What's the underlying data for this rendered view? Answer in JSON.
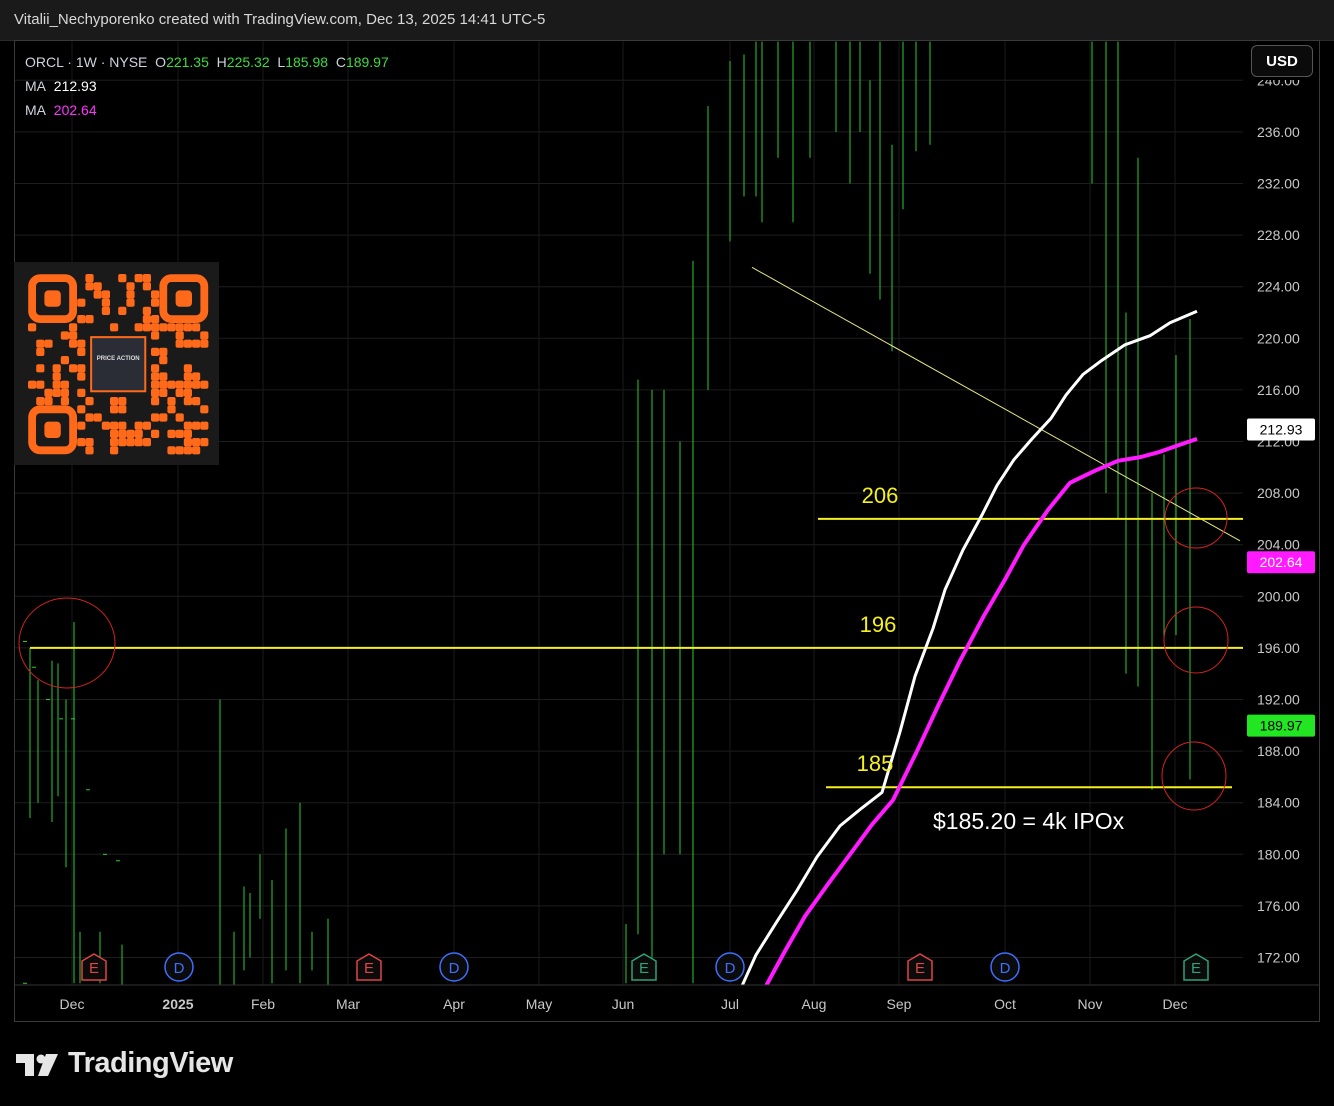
{
  "header": {
    "credit": "Vitalii_Nechyporenko created with TradingView.com, Dec 13, 2025 14:41 UTC-5"
  },
  "legend": {
    "symbol": "ORCL · 1W · NYSE",
    "o_label": "O",
    "o_value": "221.35",
    "h_label": "H",
    "h_value": "225.32",
    "l_label": "L",
    "l_value": "185.98",
    "c_label": "C",
    "c_value": "189.97",
    "ma1_label": "MA",
    "ma1_value": "212.93",
    "ma2_label": "MA",
    "ma2_value": "202.64"
  },
  "currency_button": "USD",
  "footer": {
    "brand": "TradingView"
  },
  "qr_label": "PRICE ACTION",
  "chart_data": {
    "type": "line",
    "y_axis": {
      "ticks": [
        "172.00",
        "176.00",
        "180.00",
        "184.00",
        "188.00",
        "192.00",
        "196.00",
        "200.00",
        "204.00",
        "208.00",
        "212.00",
        "216.00",
        "220.00",
        "224.00",
        "228.00",
        "232.00",
        "236.00",
        "240.00"
      ],
      "range": [
        169.8,
        243.5
      ]
    },
    "x_axis": {
      "ticks": [
        "Dec",
        "2025",
        "Feb",
        "Mar",
        "Apr",
        "May",
        "Jun",
        "Jul",
        "Aug",
        "Sep",
        "Oct",
        "Nov",
        "Dec"
      ]
    },
    "price_labels": [
      {
        "value": 212.93,
        "text": "212.93",
        "style": "ma1"
      },
      {
        "value": 202.64,
        "text": "202.64",
        "style": "ma2"
      },
      {
        "value": 189.97,
        "text": "189.97",
        "style": "last"
      }
    ],
    "horizontal_levels": [
      {
        "value": 206,
        "label": "206"
      },
      {
        "value": 196,
        "label": "196"
      },
      {
        "value": 185.2,
        "label": "185"
      }
    ],
    "annotation": "$185.20 = 4k IPOx",
    "events": [
      {
        "type": "E",
        "color": "red"
      },
      {
        "type": "D",
        "color": "blue"
      },
      {
        "type": "E",
        "color": "red"
      },
      {
        "type": "D",
        "color": "blue"
      },
      {
        "type": "E",
        "color": "green"
      },
      {
        "type": "D",
        "color": "blue"
      },
      {
        "type": "E",
        "color": "red"
      },
      {
        "type": "D",
        "color": "blue"
      },
      {
        "type": "E",
        "color": "green"
      }
    ],
    "series": [
      {
        "values": [
          [
            27,
            196.5
          ],
          [
            36,
            194.5
          ],
          [
            50,
            192
          ],
          [
            63,
            190.5
          ],
          [
            75,
            190.5
          ],
          [
            90,
            185
          ],
          [
            107,
            180
          ],
          [
            120,
            179.5
          ]
        ]
      },
      {
        "values": [
          [
            27,
            170
          ],
          [
            36,
            169.5
          ],
          [
            50,
            169.3
          ]
        ]
      }
    ],
    "bars": [
      [
        30,
        196,
        182.8
      ],
      [
        38,
        193.5,
        184
      ],
      [
        52,
        195,
        182.5
      ],
      [
        58,
        194.8,
        184.5
      ],
      [
        66,
        192,
        179
      ],
      [
        74,
        198,
        170
      ],
      [
        80,
        174,
        170
      ],
      [
        100,
        174,
        170
      ],
      [
        122,
        173,
        169.8
      ],
      [
        220,
        192,
        169.8
      ],
      [
        234,
        174,
        169.8
      ],
      [
        244,
        177.5,
        171
      ],
      [
        250,
        177,
        172
      ],
      [
        260,
        180,
        175
      ],
      [
        272,
        178,
        170
      ],
      [
        286,
        182,
        171
      ],
      [
        300,
        184,
        170
      ],
      [
        312,
        174,
        171
      ],
      [
        328,
        175,
        169.8
      ],
      [
        626,
        174.6,
        170
      ],
      [
        638,
        216.8,
        173.8
      ],
      [
        652,
        216,
        172
      ],
      [
        664,
        216,
        180
      ],
      [
        680,
        212,
        180
      ],
      [
        693,
        226,
        170
      ],
      [
        708,
        238,
        216
      ],
      [
        730,
        241.5,
        227.5
      ],
      [
        744,
        242,
        231
      ],
      [
        756,
        243,
        231
      ],
      [
        762,
        243,
        229
      ],
      [
        778,
        243,
        234
      ],
      [
        793,
        243,
        229
      ],
      [
        810,
        243,
        234
      ],
      [
        836,
        243,
        236
      ],
      [
        850,
        243,
        232
      ],
      [
        860,
        243,
        236
      ],
      [
        870,
        240,
        225
      ],
      [
        880,
        243,
        223
      ],
      [
        892,
        235,
        219
      ],
      [
        903,
        243,
        230
      ],
      [
        916,
        243,
        234.5
      ],
      [
        930,
        243,
        235
      ],
      [
        1092,
        243,
        232
      ],
      [
        1106,
        243,
        208
      ],
      [
        1118,
        243,
        206
      ],
      [
        1126,
        222,
        194
      ],
      [
        1138,
        234,
        193
      ],
      [
        1152,
        208,
        185
      ],
      [
        1164,
        211,
        196.5
      ],
      [
        1176,
        218.7,
        197
      ],
      [
        1190,
        221.5,
        185.8
      ]
    ],
    "ma_white": [
      [
        742,
        169.8
      ],
      [
        756,
        172.2
      ],
      [
        777,
        174.8
      ],
      [
        797,
        177.2
      ],
      [
        817,
        179.8
      ],
      [
        840,
        182.2
      ],
      [
        862,
        183.6
      ],
      [
        882,
        184.8
      ],
      [
        900,
        189.5
      ],
      [
        915,
        193.8
      ],
      [
        933,
        197.5
      ],
      [
        945,
        200.5
      ],
      [
        963,
        203.6
      ],
      [
        982,
        206.3
      ],
      [
        997,
        208.6
      ],
      [
        1014,
        210.6
      ],
      [
        1032,
        212.2
      ],
      [
        1051,
        213.8
      ],
      [
        1066,
        215.6
      ],
      [
        1083,
        217.2
      ],
      [
        1102,
        218.3
      ],
      [
        1125,
        219.5
      ],
      [
        1150,
        220.2
      ],
      [
        1170,
        221.2
      ],
      [
        1197,
        222.1
      ]
    ],
    "ma_magenta": [
      [
        766,
        169.8
      ],
      [
        785,
        172.5
      ],
      [
        805,
        175.2
      ],
      [
        829,
        177.8
      ],
      [
        852,
        180.2
      ],
      [
        872,
        182.3
      ],
      [
        893,
        184.2
      ],
      [
        917,
        188
      ],
      [
        938,
        191.5
      ],
      [
        960,
        195
      ],
      [
        984,
        198.5
      ],
      [
        1005,
        201.3
      ],
      [
        1024,
        204
      ],
      [
        1048,
        206.7
      ],
      [
        1070,
        208.8
      ],
      [
        1094,
        209.7
      ],
      [
        1118,
        210.5
      ],
      [
        1141,
        210.8
      ],
      [
        1160,
        211.2
      ],
      [
        1178,
        211.7
      ],
      [
        1197,
        212.2
      ]
    ],
    "trendline": [
      [
        752,
        225.5
      ],
      [
        1240,
        204.3
      ]
    ]
  }
}
